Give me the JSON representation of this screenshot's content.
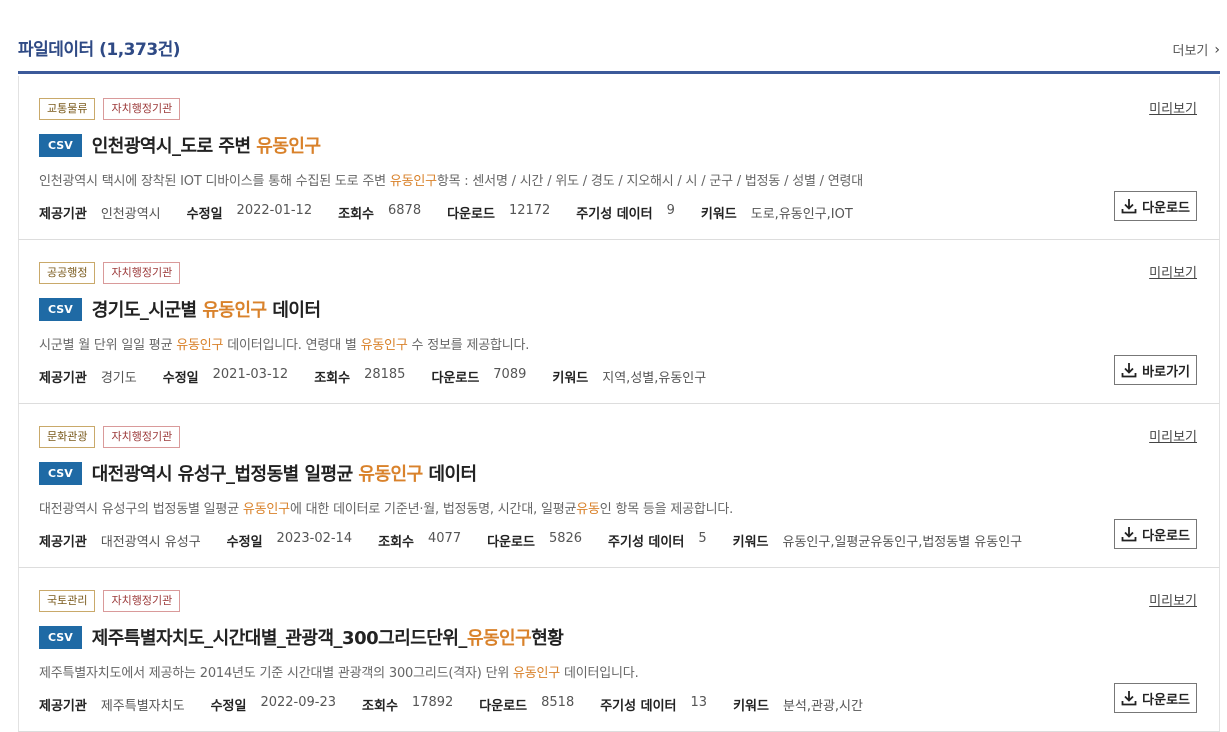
{
  "header": {
    "title": "파일데이터 (1,373건)",
    "more_label": "더보기"
  },
  "meta_labels": {
    "provider": "제공기관",
    "modified": "수정일",
    "views": "조회수",
    "downloads": "다운로드",
    "cycle": "주기성 데이터",
    "keywords": "키워드"
  },
  "preview_label": "미리보기",
  "format_label": "CSV",
  "items": [
    {
      "cat": "교통물류",
      "org": "자치행정기관",
      "title_pre": "인천광역시_도로 주변 ",
      "title_hl": "유동인구",
      "title_post": "",
      "desc_pre": "인천광역시 택시에 장착된 IOT 디바이스를 통해 수집된 도로 주변 ",
      "desc_hl": "유동인구",
      "desc_post": "항목 : 센서명 / 시간 / 위도 / 경도 / 지오해시 / 시 / 군구 / 법정동 / 성별 / 연령대",
      "provider": "인천광역시",
      "modified": "2022-01-12",
      "views": "6878",
      "downloads": "12172",
      "cycle": "9",
      "keywords": "도로,유동인구,IOT",
      "button": "다운로드"
    },
    {
      "cat": "공공행정",
      "org": "자치행정기관",
      "title_pre": "경기도_시군별 ",
      "title_hl": "유동인구",
      "title_post": " 데이터",
      "desc_pre": "시군별 월 단위 일일 평균 ",
      "desc_hl": "유동인구",
      "desc_mid": " 데이터입니다. 연령대 별 ",
      "desc_hl2": "유동인구",
      "desc_post": " 수 정보를 제공합니다.",
      "provider": "경기도",
      "modified": "2021-03-12",
      "views": "28185",
      "downloads": "7089",
      "keywords": "지역,성별,유동인구",
      "button": "바로가기"
    },
    {
      "cat": "문화관광",
      "org": "자치행정기관",
      "title_pre": "대전광역시 유성구_법정동별 일평균 ",
      "title_hl": "유동인구",
      "title_post": " 데이터",
      "desc_pre": "대전광역시 유성구의 법정동별 일평균 ",
      "desc_hl": "유동인구",
      "desc_mid": "에 대한 데이터로 기준년·월, 법정동명, 시간대, 일평균",
      "desc_hl2": "유동",
      "desc_post": "인 항목 등을 제공합니다.",
      "provider": "대전광역시 유성구",
      "modified": "2023-02-14",
      "views": "4077",
      "downloads": "5826",
      "cycle": "5",
      "keywords": "유동인구,일평균유동인구,법정동별 유동인구",
      "button": "다운로드"
    },
    {
      "cat": "국토관리",
      "org": "자치행정기관",
      "title_pre": "제주특별자치도_시간대별_관광객_300그리드단위_",
      "title_hl": "유동인구",
      "title_post": "현황",
      "desc_pre": "제주특별자치도에서 제공하는 2014년도 기준 시간대별 관광객의 300그리드(격자) 단위 ",
      "desc_hl": "유동인구",
      "desc_post": " 데이터입니다.",
      "provider": "제주특별자치도",
      "modified": "2022-09-23",
      "views": "17892",
      "downloads": "8518",
      "cycle": "13",
      "keywords": "분석,관광,시간",
      "button": "다운로드"
    }
  ]
}
